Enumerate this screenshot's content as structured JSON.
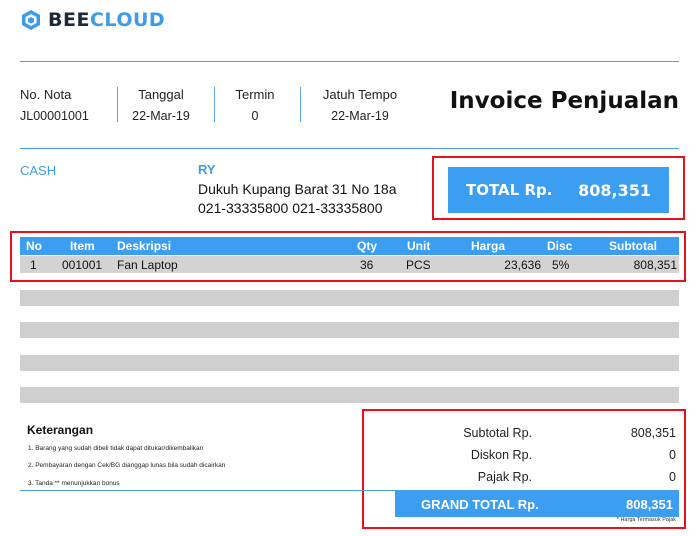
{
  "brand": {
    "part1": "BEE",
    "part2": "CLOUD",
    "icon": "beecloud-hexagon-icon",
    "colors": {
      "dark": "#1b2a3a",
      "accent": "#3d9be9"
    }
  },
  "document_title": "Invoice Penjualan",
  "meta": [
    {
      "label": "No. Nota",
      "value": "JL00001001"
    },
    {
      "label": "Tanggal",
      "value": "22-Mar-19"
    },
    {
      "label": "Termin",
      "value": "0"
    },
    {
      "label": "Jatuh Tempo",
      "value": "22-Mar-19"
    }
  ],
  "payment_type": "CASH",
  "customer": {
    "name": "RY",
    "address": "Dukuh Kupang Barat 31 No 18a",
    "phone": "021-33335800 021-33335800"
  },
  "total": {
    "label": "TOTAL Rp.",
    "value": "808,351"
  },
  "table": {
    "headers": {
      "no": "No",
      "item": "Item",
      "desc": "Deskripsi",
      "qty": "Qty",
      "unit": "Unit",
      "price": "Harga",
      "disc": "Disc",
      "subtotal": "Subtotal"
    },
    "rows": [
      {
        "no": "1",
        "item": "001001",
        "desc": "Fan Laptop",
        "qty": "36",
        "unit": "PCS",
        "price": "23,636",
        "disc": "5%",
        "subtotal": "808,351"
      }
    ]
  },
  "notes": {
    "title": "Keterangan",
    "items": [
      "1. Barang yang sudah dibeli tidak dapat ditukar/dikembalikan",
      "2. Pembayaran dengan Cek/BG dianggap lunas bila sudah dicairkan",
      "3. Tanda ** menunjukkan bonus"
    ]
  },
  "summary": {
    "subtotal": {
      "label": "Subtotal Rp.",
      "value": "808,351"
    },
    "discount": {
      "label": "Diskon Rp.",
      "value": "0"
    },
    "tax": {
      "label": "Pajak Rp.",
      "value": "0"
    },
    "grand_total": {
      "label": "GRAND TOTAL Rp.",
      "value": "808,351"
    },
    "footnote": "* Harga Termasuk Pajak"
  },
  "colors": {
    "accent": "#3b9ef0",
    "highlight": "#e5121b",
    "row_fill": "#d3d3d3"
  }
}
